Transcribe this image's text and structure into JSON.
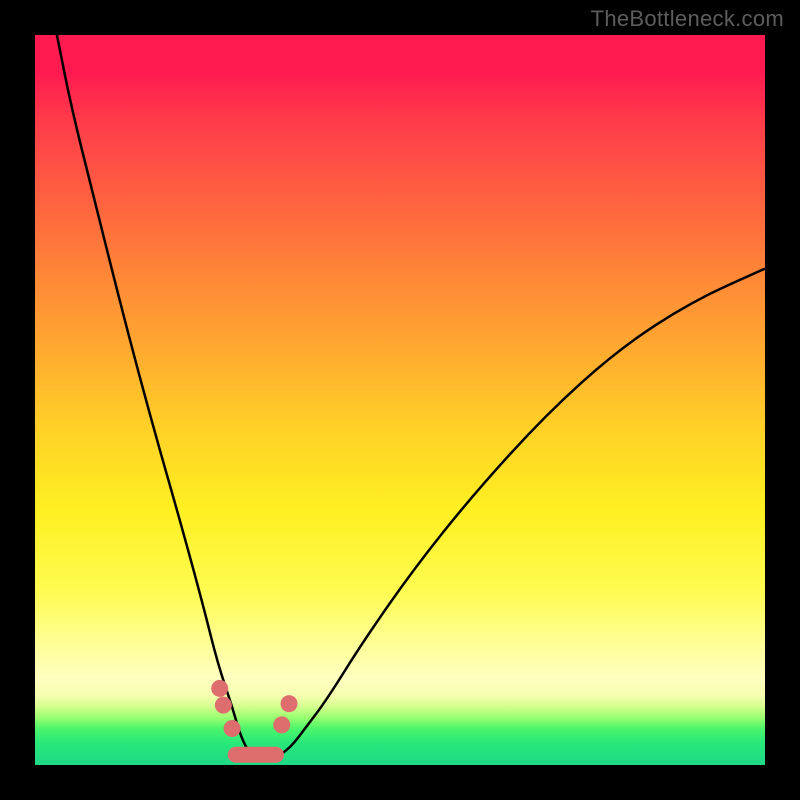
{
  "watermark": "TheBottleneck.com",
  "chart_data": {
    "type": "line",
    "title": "",
    "xlabel": "",
    "ylabel": "",
    "x_range": [
      0,
      100
    ],
    "y_range": [
      0,
      100
    ],
    "curve_note": "V-shaped bottleneck curve; minimum near x≈30%, asymmetric rise sharper on left side. Values are approximate (read from unlabeled gradient axis).",
    "series": [
      {
        "name": "bottleneck-curve",
        "x": [
          3,
          5,
          8,
          12,
          16,
          20,
          23,
          25,
          27,
          28,
          29,
          30,
          31,
          32,
          33,
          35,
          37,
          40,
          45,
          52,
          60,
          70,
          80,
          90,
          100
        ],
        "y": [
          100,
          90,
          78,
          62,
          47,
          33,
          22,
          14,
          8,
          4.5,
          2.2,
          1.0,
          0.6,
          0.6,
          1.0,
          2.4,
          5,
          9,
          17,
          27,
          37,
          48,
          57,
          63.5,
          68
        ]
      }
    ],
    "markers": {
      "note": "salmon highlight dots and bar near curve minimum",
      "points_x": [
        25.3,
        25.8,
        27.0,
        33.8,
        34.8
      ],
      "points_y": [
        10.5,
        8.2,
        5.0,
        5.5,
        8.4
      ],
      "bottom_bar": {
        "x_start": 27.5,
        "x_end": 33.0,
        "y": 1.4
      }
    },
    "background_gradient": {
      "top": "#ff1a50",
      "mid": "#fff022",
      "bottom": "#1fd885"
    }
  }
}
